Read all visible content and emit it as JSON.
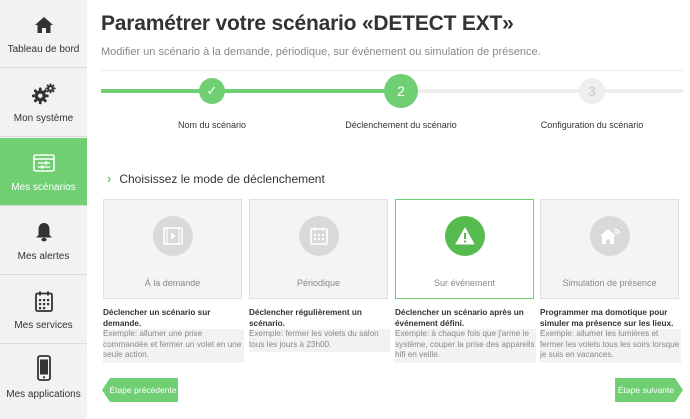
{
  "sidebar": {
    "items": [
      {
        "label": "Tableau de bord",
        "icon": "home-icon"
      },
      {
        "label": "Mon système",
        "icon": "gears-icon"
      },
      {
        "label": "Mes scénarios",
        "icon": "scenario-sliders-icon",
        "active": true
      },
      {
        "label": "Mes alertes",
        "icon": "bell-icon"
      },
      {
        "label": "Mes services",
        "icon": "calendar-icon"
      },
      {
        "label": "Mes applications",
        "icon": "smartphone-icon"
      }
    ]
  },
  "header": {
    "title": "Paramétrer votre scénario «DETECT EXT»",
    "subtitle": "Modifier un scénario à la demande, périodique, sur événement ou simulation de présence."
  },
  "stepper": {
    "steps": [
      {
        "number": "✓",
        "label": "Nom du scénario",
        "state": "done"
      },
      {
        "number": "2",
        "label": "Déclenchement du scénario",
        "state": "current"
      },
      {
        "number": "3",
        "label": "Configuration du scénario",
        "state": "todo"
      }
    ]
  },
  "section": {
    "heading": "Choisissez le mode de déclenchement"
  },
  "modes": [
    {
      "label": "À la demande",
      "icon": "video-play-icon",
      "selected": false,
      "desc_title": "Déclencher un scénario sur demande.",
      "desc_example": "Exemple: allumer une prise commandée et fermer un volet en une seule action."
    },
    {
      "label": "Périodique",
      "icon": "calendar-grid-icon",
      "selected": false,
      "desc_title": "Déclencher régulièrement un scénario.",
      "desc_example": "Exemple: fermer les volets du salon tous les jours à 23h00."
    },
    {
      "label": "Sur événement",
      "icon": "warning-icon",
      "selected": true,
      "desc_title": "Déclencher un scénario après un événement défini.",
      "desc_example": "Exemple: à chaque fois que j'arme le système, couper la prise des appareils hifi en veille."
    },
    {
      "label": "Simulation de présence",
      "icon": "house-signal-icon",
      "selected": false,
      "desc_title": "Programmer ma domotique pour simuler ma présence sur les lieux.",
      "desc_example": "Exemple: allumer les lumières et fermer les volets tous les soirs lorsque je suis en vacances."
    }
  ],
  "footer": {
    "prev_label": "Étape précédente",
    "next_label": "Étape suivante"
  },
  "colors": {
    "accent": "#6fcf72",
    "selected_icon": "#55bb4e",
    "muted_icon": "#d9d9d9"
  }
}
